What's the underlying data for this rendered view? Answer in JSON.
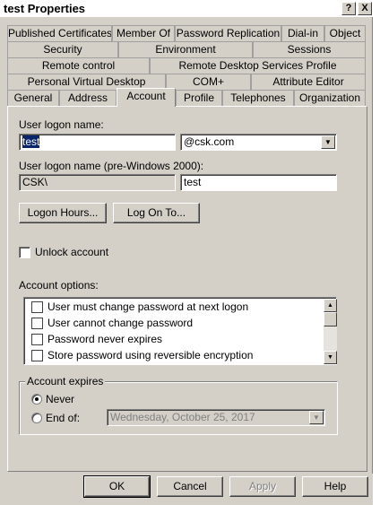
{
  "window": {
    "title": "test Properties",
    "help_glyph": "?",
    "close_glyph": "X"
  },
  "tabs": {
    "row1": [
      "Published Certificates",
      "Member Of",
      "Password Replication",
      "Dial-in",
      "Object"
    ],
    "row2": [
      "Security",
      "Environment",
      "Sessions"
    ],
    "row3": [
      "Remote control",
      "Remote Desktop Services Profile"
    ],
    "row4": [
      "Personal Virtual Desktop",
      "COM+",
      "Attribute Editor"
    ],
    "row5": [
      "General",
      "Address",
      "Account",
      "Profile",
      "Telephones",
      "Organization"
    ],
    "active": "Account"
  },
  "account": {
    "logon_name_label": "User logon name:",
    "logon_name_value": "test",
    "domain_value": "@csk.com",
    "pre2000_label": "User logon name (pre-Windows 2000):",
    "pre2000_domain": "CSK\\",
    "pre2000_name": "test",
    "logon_hours_button": "Logon Hours...",
    "logon_to_button": "Log On To...",
    "unlock_label": "Unlock account",
    "options_label": "Account options:",
    "options": [
      "User must change password at next logon",
      "User cannot change password",
      "Password never expires",
      "Store password using reversible encryption"
    ],
    "expires_label": "Account expires",
    "never_label": "Never",
    "end_of_label": "End of:",
    "end_date": "Wednesday,   October   25, 2017"
  },
  "footer": {
    "ok": "OK",
    "cancel": "Cancel",
    "apply": "Apply",
    "help": "Help"
  }
}
